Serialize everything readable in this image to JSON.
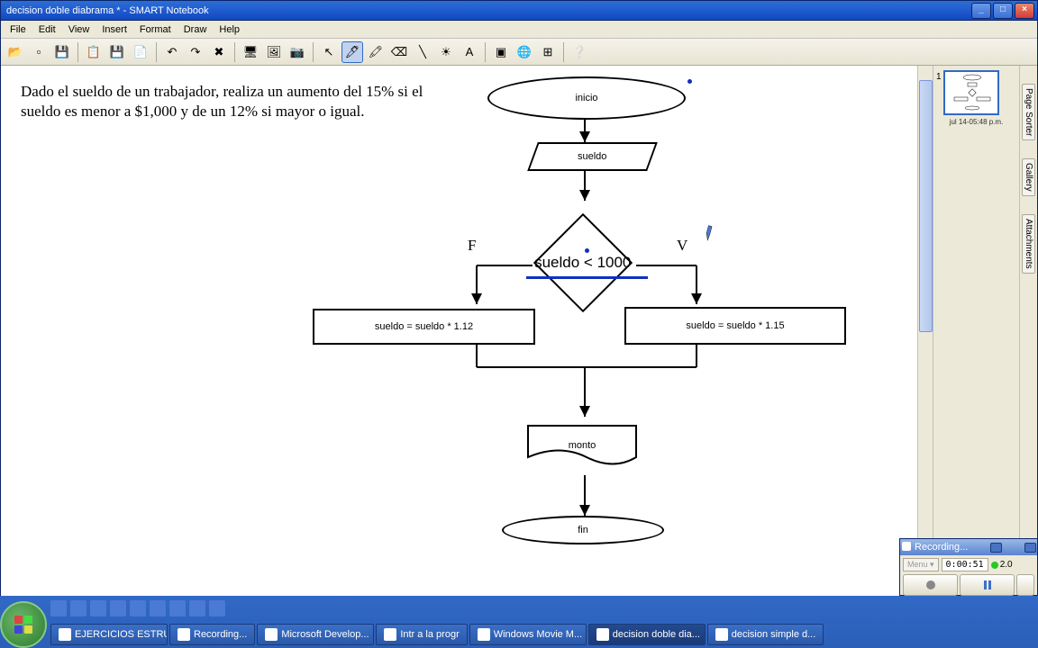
{
  "title": "decision doble diabrama * - SMART Notebook",
  "menus": [
    "File",
    "Edit",
    "View",
    "Insert",
    "Format",
    "Draw",
    "Help"
  ],
  "sidetabs": [
    "Page Sorter",
    "Gallery",
    "Attachments"
  ],
  "thumb": {
    "num": "1",
    "date": "jul 14-05:48 p.m."
  },
  "problem": "Dado el sueldo de un trabajador, realiza un aumento del 15% si el sueldo es menor a $1,000 y de un 12% si mayor o igual.",
  "flow": {
    "inicio": "inicio",
    "sueldo": "sueldo",
    "cond": "sueldo < 1000",
    "F": "F",
    "V": "V",
    "false_branch": "sueldo = sueldo * 1.12",
    "true_branch": "sueldo = sueldo * 1.15",
    "monto": "monto",
    "fin": "fin"
  },
  "recording": {
    "title": "Recording...",
    "menu": "Menu ▾",
    "time": "0:00:51",
    "speed": "2.0"
  },
  "taskbar": {
    "items": [
      "EJERCICIOS ESTRU...",
      "Recording...",
      "Microsoft Develop...",
      "Intr a la progr",
      "Windows Movie M...",
      "decision doble dia...",
      "decision simple d..."
    ]
  }
}
